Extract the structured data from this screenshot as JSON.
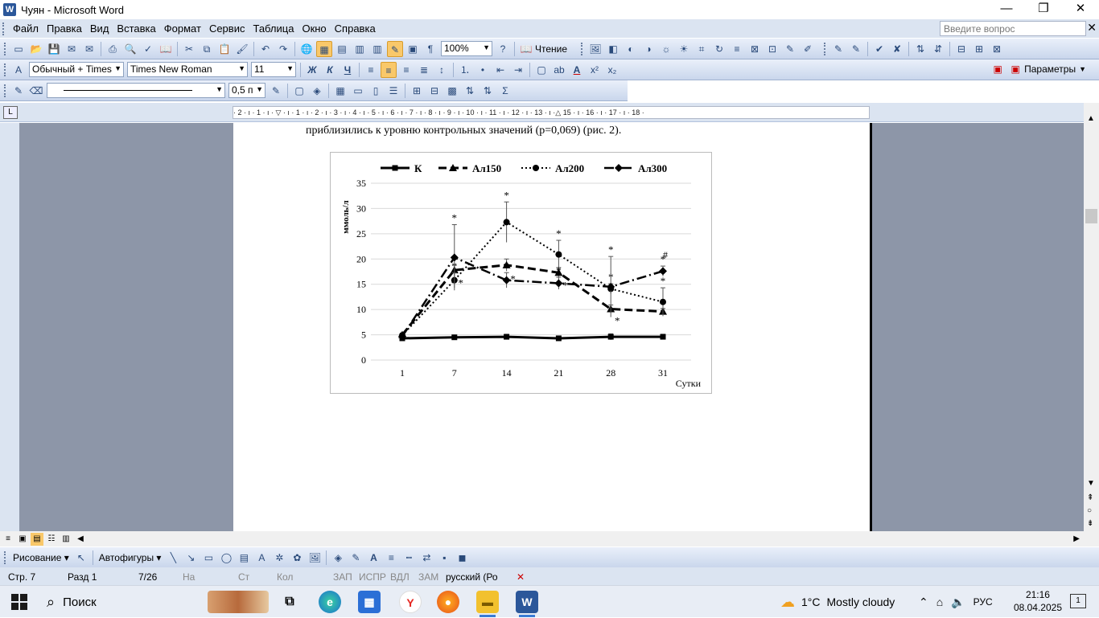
{
  "window": {
    "title": "Чуян - Microsoft Word",
    "app_icon": "W"
  },
  "menu": {
    "items": [
      "Файл",
      "Правка",
      "Вид",
      "Вставка",
      "Формат",
      "Сервис",
      "Таблица",
      "Окно",
      "Справка"
    ],
    "ask_placeholder": "Введите вопрос"
  },
  "toolbar1": {
    "zoom": "100%",
    "reading_label": "Чтение"
  },
  "toolbar2": {
    "style": "Обычный + Times",
    "font": "Times New Roman",
    "size": "11",
    "bold": "Ж",
    "italic": "К",
    "underline": "Ч",
    "params_label": "Параметры"
  },
  "toolbar3": {
    "line_width": "0,5 п"
  },
  "ruler": {
    "numbers": "· 2 · ı · 1 · ı · ▽ · ı · 1 · ı · 2 · ı · 3 · ı · 4 · ı · 5 · ı · 6 · ı · 7 · ı · 8 · ı · 9 · ı · 10 · ı · 11 · ı · 12 · ı · 13 · ı ·△ 15 · ı · 16 · ı · 17 · ı · 18 ·"
  },
  "document": {
    "text": "приблизились к уровню контрольных значений (р=0,069) (рис. 2)."
  },
  "chart_data": {
    "type": "line",
    "categories": [
      "1",
      "7",
      "14",
      "21",
      "28",
      "31"
    ],
    "xlabel": "Сутки",
    "ylabel": "ммоль/л",
    "ylim": [
      0,
      35
    ],
    "yticks": [
      "0",
      "5",
      "10",
      "15",
      "20",
      "25",
      "30",
      "35"
    ],
    "legend_position": "top",
    "series": [
      {
        "name": "К",
        "style": "solid",
        "marker": "square",
        "values": [
          4.3,
          4.5,
          4.6,
          4.3,
          4.6,
          4.6
        ],
        "err": [
          0.3,
          0.3,
          0.5,
          0.4,
          0.6,
          0.5
        ],
        "stars": []
      },
      {
        "name": "Ал150",
        "style": "dashed",
        "marker": "triangle",
        "values": [
          5.0,
          17.8,
          18.8,
          17.3,
          10.1,
          9.6
        ],
        "err": [
          0.3,
          1.0,
          1.2,
          1.0,
          0.8,
          0.6
        ],
        "stars": [
          "",
          "*",
          "*",
          "*",
          "*",
          ""
        ]
      },
      {
        "name": "Ал200",
        "style": "dotted",
        "marker": "circle",
        "values": [
          4.9,
          15.8,
          27.3,
          20.9,
          14.1,
          11.5
        ],
        "err": [
          0.3,
          1.5,
          4.0,
          2.8,
          1.0,
          2.8
        ],
        "stars": [
          "",
          "*",
          "*",
          "*",
          "*",
          "*"
        ]
      },
      {
        "name": "Ал300",
        "style": "dashdot",
        "marker": "diamond",
        "values": [
          4.7,
          20.3,
          15.8,
          15.2,
          14.5,
          17.6
        ],
        "err": [
          0.3,
          6.5,
          1.5,
          1.2,
          6.0,
          1.0
        ],
        "stars": [
          "",
          "*",
          "*",
          "*",
          "*",
          "*"
        ]
      }
    ],
    "extra_marks": [
      {
        "category": "31",
        "text": "#"
      }
    ]
  },
  "drawbar": {
    "draw_label": "Рисование ▾",
    "autoshapes_label": "Автофигуры ▾"
  },
  "status": {
    "page": "Стр. 7",
    "section": "Разд 1",
    "pages": "7/26",
    "at": "На",
    "line": "Ст",
    "col": "Кол",
    "rec": "ЗАП",
    "trk": "ИСПР",
    "ext": "ВДЛ",
    "ovr": "ЗАМ",
    "lang": "русский (Ро"
  },
  "taskbar": {
    "search": "Поиск",
    "weather_temp": "1°C",
    "weather_text": "Mostly cloudy",
    "lang": "РУС",
    "time": "21:16",
    "date": "08.04.2025",
    "notif": "1"
  },
  "colors": {
    "menu_bg": "#dbe4f1",
    "doc_bg": "#8d96a8",
    "active_btn": "#f9c86a"
  }
}
